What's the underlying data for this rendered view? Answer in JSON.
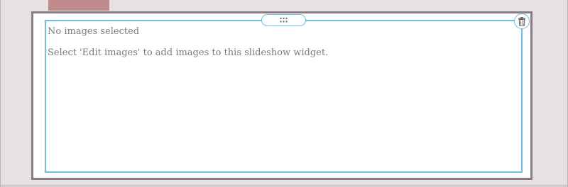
{
  "widget": {
    "title": "No images selected",
    "description": "Select 'Edit images' to add images to this slideshow widget.",
    "drag_handle_icon": "drag-grip-icon",
    "delete_icon": "trash-icon"
  },
  "colors": {
    "accent": "#6ebdf0",
    "frame": "#8a7d82",
    "background": "#e6e2e2",
    "tab": "#c08b8b",
    "text": "#7d7a7a"
  }
}
